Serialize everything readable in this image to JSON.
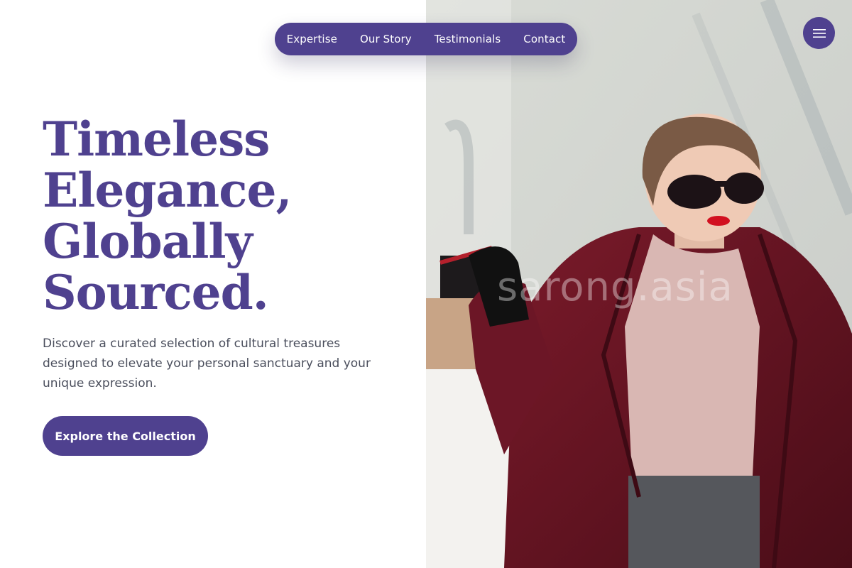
{
  "nav": {
    "items": [
      {
        "label": "Expertise"
      },
      {
        "label": "Our Story"
      },
      {
        "label": "Testimonials"
      },
      {
        "label": "Contact"
      }
    ],
    "menu_icon": "hamburger-menu-icon"
  },
  "hero": {
    "headline_lines": [
      "Timeless",
      "Elegance,",
      "Globally",
      "Sourced."
    ],
    "description": "Discover a curated selection of cultural treasures designed to elevate your personal sanctuary and your unique expression.",
    "cta_label": "Explore the Collection",
    "image_watermark": "sarong.asia"
  },
  "colors": {
    "accent": "#4f418f",
    "text_body": "#4a4e5c",
    "background": "#ffffff"
  }
}
